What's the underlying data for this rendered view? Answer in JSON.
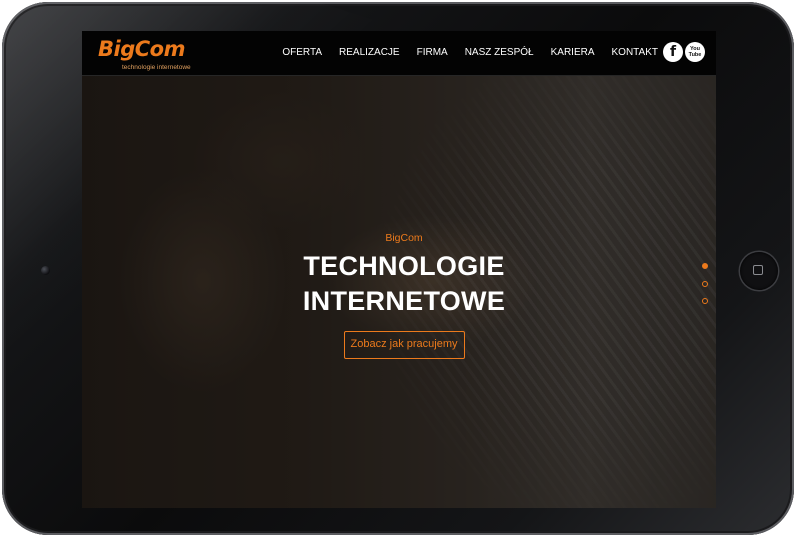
{
  "brand": {
    "logo_text": "BigCom",
    "tagline": "technologie internetowe",
    "accent_color": "#ec7a1c"
  },
  "nav": {
    "items": [
      {
        "label": "OFERTA"
      },
      {
        "label": "REALIZACJE"
      },
      {
        "label": "FIRMA"
      },
      {
        "label": "NASZ ZESPÓŁ"
      },
      {
        "label": "KARIERA"
      },
      {
        "label": "KONTAKT"
      }
    ],
    "social": [
      {
        "icon": "facebook-icon",
        "glyph": "f"
      },
      {
        "icon": "youtube-icon",
        "line1": "You",
        "line2": "Tube"
      }
    ]
  },
  "hero": {
    "eyebrow": "BigCom",
    "title_line1": "TECHNOLOGIE",
    "title_line2": "INTERNETOWE",
    "cta_label": "Zobacz jak pracujemy"
  },
  "slider": {
    "slide_count": 3,
    "active_index": 0
  }
}
